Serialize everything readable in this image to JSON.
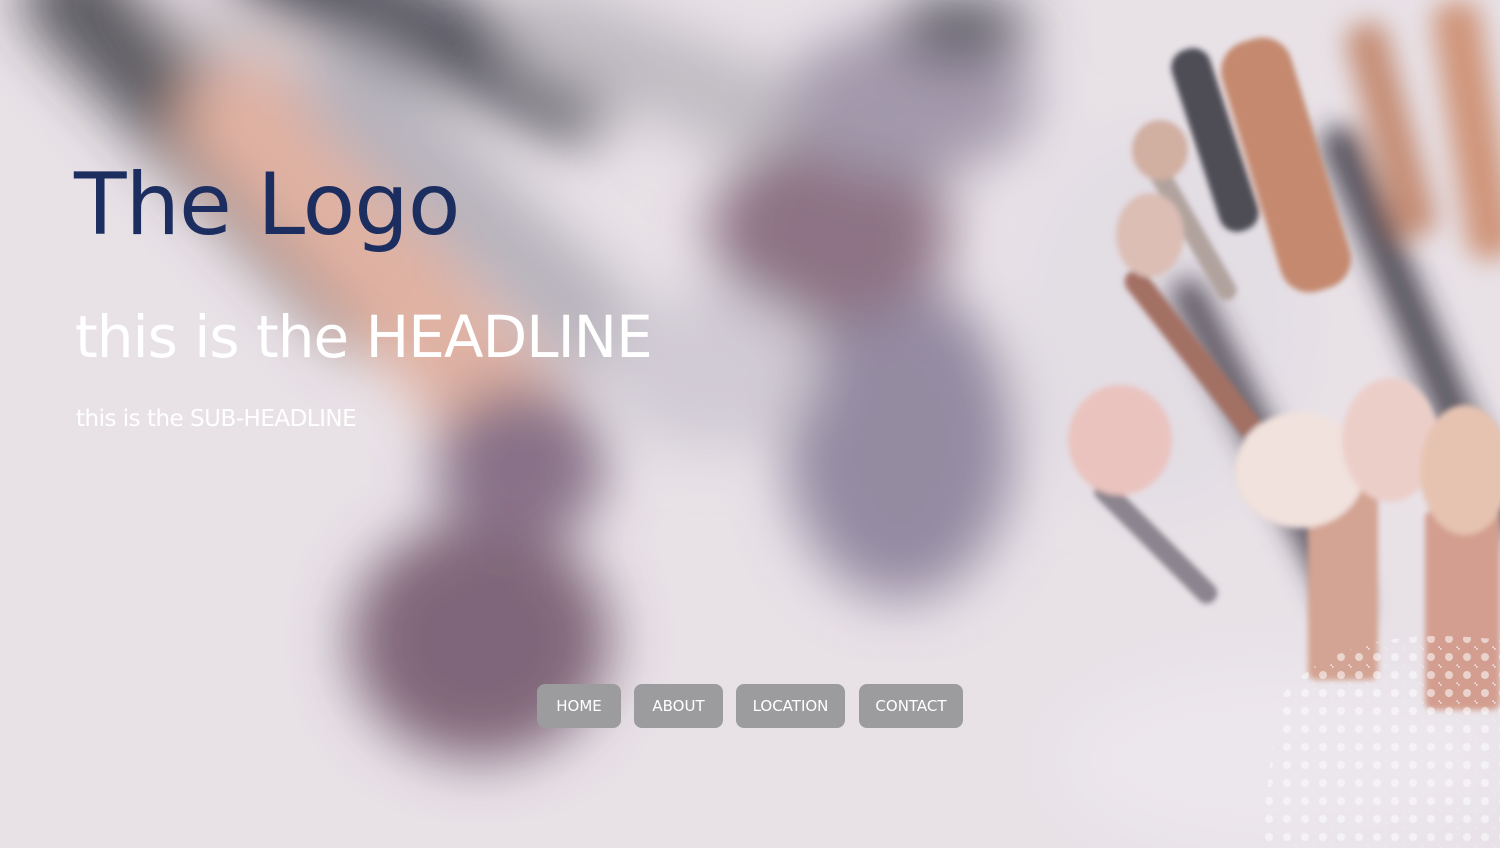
{
  "hero": {
    "logo": "The Logo",
    "headline": "this is the HEADLINE",
    "subheadline": "this is the SUB-HEADLINE",
    "background_image": "blurred makeup brushes"
  },
  "nav": {
    "items": [
      {
        "label": "HOME"
      },
      {
        "label": "ABOUT"
      },
      {
        "label": "LOCATION"
      },
      {
        "label": "CONTACT"
      }
    ]
  },
  "colors": {
    "logo": "#1c2d5f",
    "nav_button": "#9c9c9f",
    "text": "#ffffff",
    "background": "#e4dde3"
  }
}
